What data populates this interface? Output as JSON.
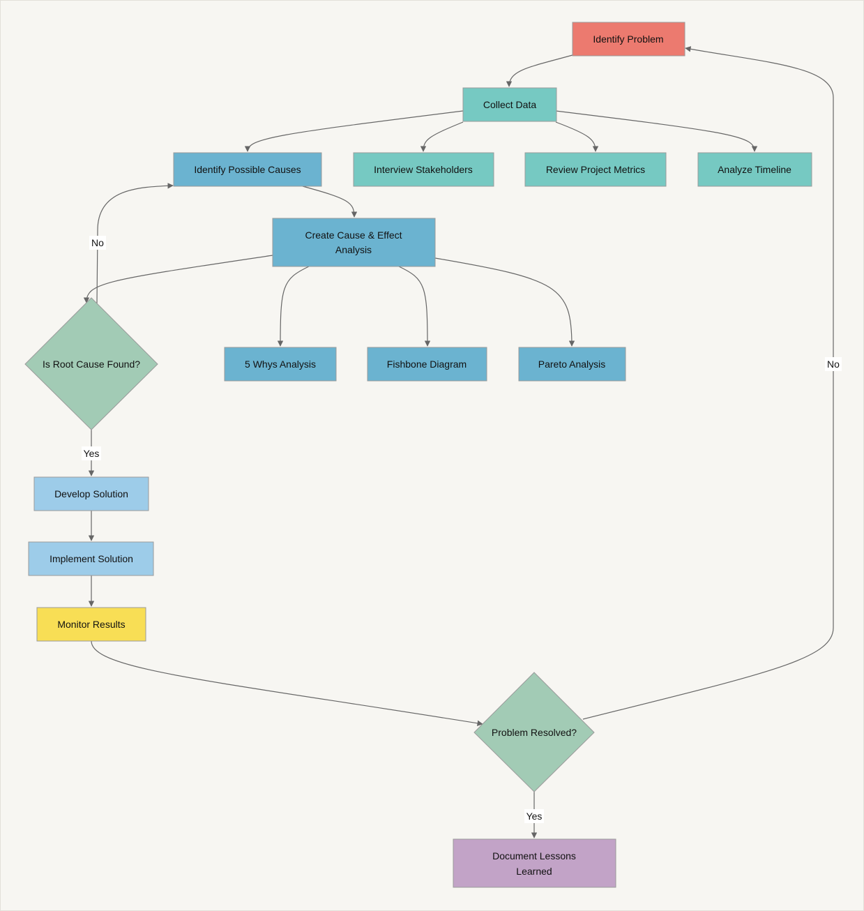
{
  "colors": {
    "background": "#f7f6f2",
    "problem": "#ec7a6f",
    "data": "#76c9c2",
    "analysis": "#6bb3d0",
    "solution": "#9dcce9",
    "monitor": "#f8de55",
    "decision": "#a2cbb5",
    "document": "#c2a3c7"
  },
  "nodes": {
    "identify_problem": "Identify Problem",
    "collect_data": "Collect Data",
    "identify_causes": "Identify Possible Causes",
    "interview": "Interview Stakeholders",
    "review_metrics": "Review Project Metrics",
    "analyze_timeline": "Analyze Timeline",
    "cause_effect_1": "Create Cause & Effect",
    "cause_effect_2": "Analysis",
    "root_cause": "Is Root Cause Found?",
    "five_whys": "5 Whys Analysis",
    "fishbone": "Fishbone Diagram",
    "pareto": "Pareto Analysis",
    "develop": "Develop Solution",
    "implement": "Implement Solution",
    "monitor": "Monitor Results",
    "resolved": "Problem Resolved?",
    "document_1": "Document Lessons",
    "document_2": "Learned"
  },
  "edge_labels": {
    "root_no": "No",
    "root_yes": "Yes",
    "resolved_no": "No",
    "resolved_yes": "Yes"
  }
}
